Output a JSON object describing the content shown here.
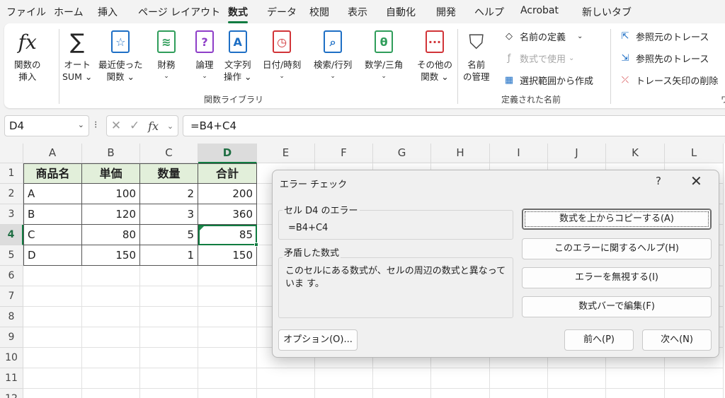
{
  "menu": {
    "tabs": [
      "ファイル",
      "ホーム",
      "挿入",
      "ページ レイアウト",
      "数式",
      "データ",
      "校閲",
      "表示",
      "自動化",
      "開発",
      "ヘルプ",
      "Acrobat",
      "新しいタブ"
    ],
    "active": "数式"
  },
  "ribbon": {
    "insert_function": {
      "line1": "関数の",
      "line2": "挿入"
    },
    "autosum": {
      "line1": "オート",
      "line2": "SUM ⌄"
    },
    "recent": {
      "line1": "最近使った",
      "line2": "関数 ⌄"
    },
    "financial": {
      "line1": "財務",
      "line2": "⌄"
    },
    "logical": {
      "line1": "論理",
      "line2": "⌄"
    },
    "text": {
      "line1": "文字列",
      "line2": "操作 ⌄"
    },
    "datetime": {
      "line1": "日付/時刻",
      "line2": "⌄"
    },
    "lookup": {
      "line1": "検索/行列",
      "line2": "⌄"
    },
    "math": {
      "line1": "数学/三角",
      "line2": "⌄"
    },
    "other": {
      "line1": "その他の",
      "line2": "関数 ⌄"
    },
    "group_library": "関数ライブラリ",
    "name_manager": {
      "line1": "名前",
      "line2": "の管理"
    },
    "define_name": "名前の定義",
    "use_in_formula": "数式で使用",
    "create_from_selection": "選択範囲から作成",
    "group_names": "定義された名前",
    "trace_precedents": "参照元のトレース",
    "trace_dependents": "参照先のトレース",
    "remove_arrows": "トレース矢印の削除",
    "group_audit_partial": "ワ"
  },
  "formula_bar": {
    "name_box": "D4",
    "formula": "=B4+C4"
  },
  "grid": {
    "columns": [
      "A",
      "B",
      "C",
      "D",
      "E",
      "F",
      "G",
      "H",
      "I",
      "J",
      "K",
      "L"
    ],
    "rows": [
      "1",
      "2",
      "3",
      "4",
      "5",
      "6",
      "7",
      "8",
      "9",
      "10",
      "11",
      "12"
    ],
    "table": {
      "headers": [
        "商品名",
        "単価",
        "数量",
        "合計"
      ],
      "rows": [
        [
          "A",
          "100",
          "2",
          "200"
        ],
        [
          "B",
          "120",
          "3",
          "360"
        ],
        [
          "C",
          "80",
          "5",
          "85"
        ],
        [
          "D",
          "150",
          "1",
          "150"
        ]
      ]
    },
    "header_fill_color": "#e2efda",
    "selection_color": "#107c41"
  },
  "dialog": {
    "title": "エラー チェック",
    "help": "?",
    "close": "✕",
    "error_cell_label": "セル D4 のエラー",
    "error_formula": "=B4+C4",
    "error_type_label": "矛盾した数式",
    "description": "このセルにある数式が、セルの周辺の数式と異なっていま す。",
    "copy_from_above": "数式を上からコピーする(A)",
    "help_on_error": "このエラーに関するヘルプ(H)",
    "ignore_error": "エラーを無視する(I)",
    "edit_in_bar": "数式バーで編集(F)",
    "options": "オプション(O)...",
    "previous": "前へ(P)",
    "next": "次へ(N)"
  }
}
